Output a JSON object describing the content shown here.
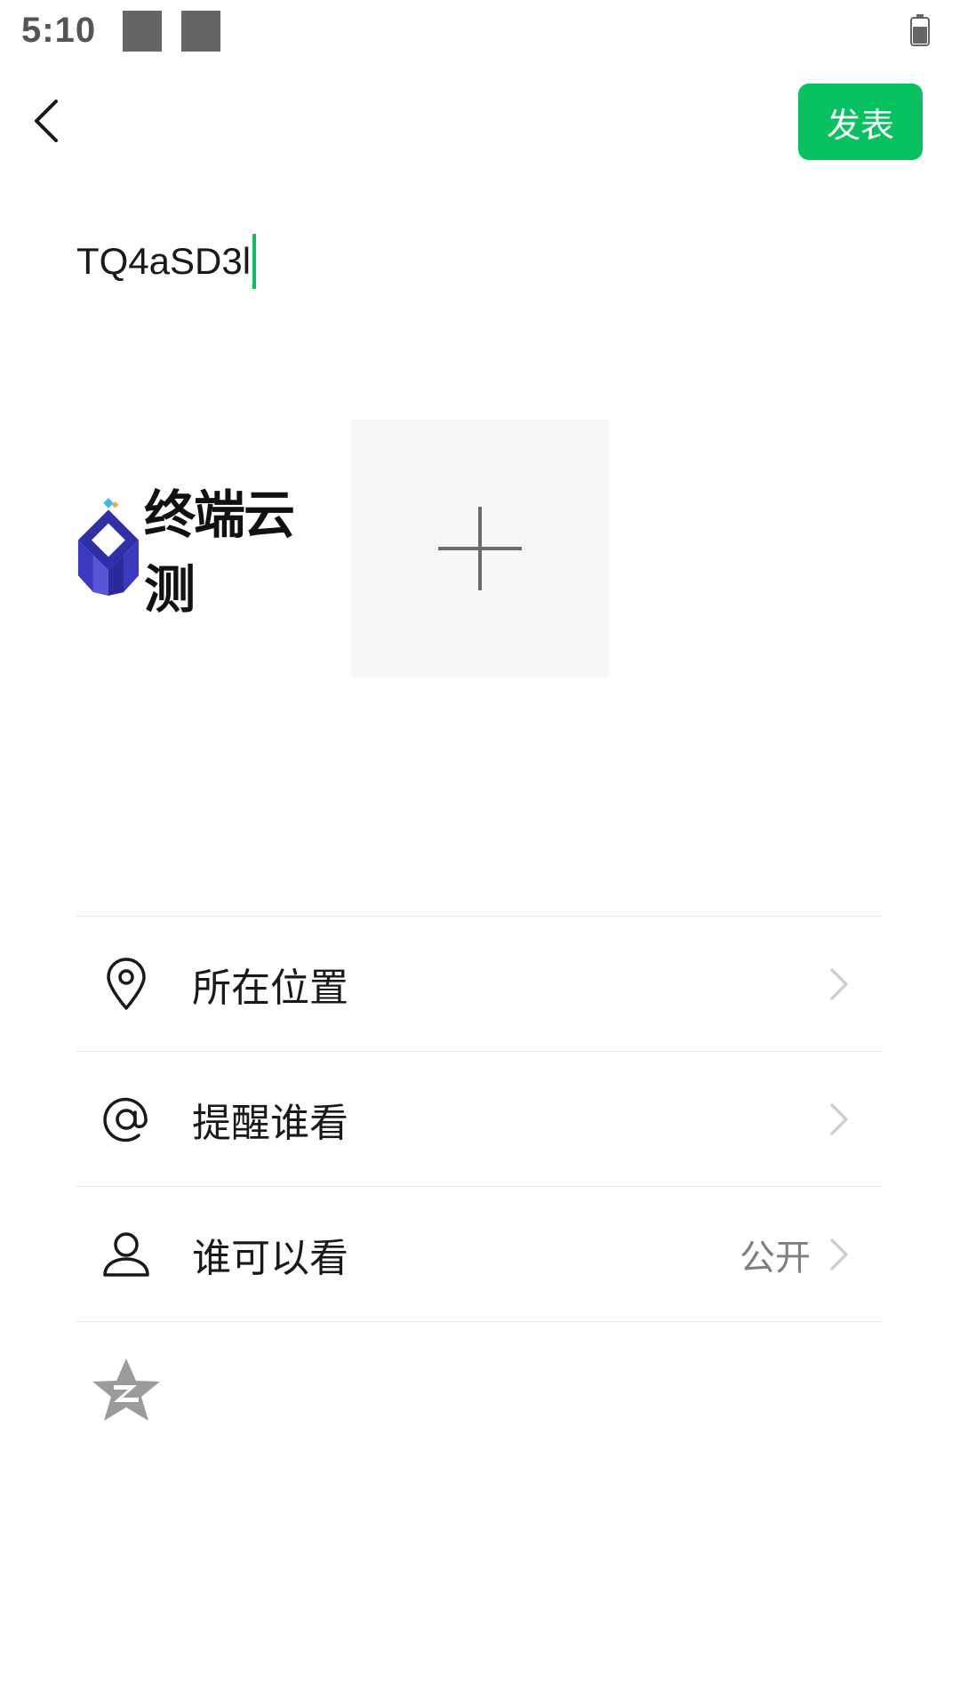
{
  "status_bar": {
    "time": "5:10",
    "icons": [
      "notification-icon",
      "notification-icon",
      "battery-icon"
    ]
  },
  "header": {
    "back_icon": "back-arrow-icon",
    "publish_label": "发表",
    "accent_color": "#07c160"
  },
  "composer": {
    "text": "TQ4aSD3l"
  },
  "images": {
    "thumb": {
      "logo_icon": "diamond-logo-icon",
      "logo_text": "终端云测"
    },
    "add_icon": "plus-icon"
  },
  "options": [
    {
      "icon": "location-pin-icon",
      "label": "所在位置",
      "value": ""
    },
    {
      "icon": "at-sign-icon",
      "label": "提醒谁看",
      "value": ""
    },
    {
      "icon": "person-icon",
      "label": "谁可以看",
      "value": "公开"
    }
  ],
  "share": {
    "icon": "qzone-star-icon"
  }
}
